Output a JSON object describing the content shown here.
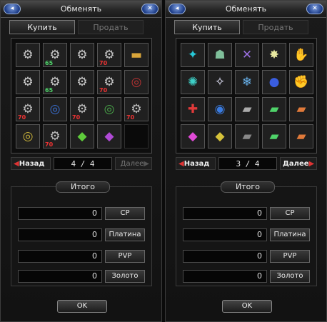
{
  "left": {
    "title": "Обменять",
    "tabs": [
      {
        "label": "Купить",
        "active": true
      },
      {
        "label": "Продать",
        "active": false
      }
    ],
    "slots": [
      {
        "icon": "robot-mech-icon",
        "glyph": "⚙",
        "color": "#c8c8c8",
        "badge": ""
      },
      {
        "icon": "robot-mech-icon",
        "glyph": "⚙",
        "color": "#c8c8c8",
        "badge": "65",
        "badge_color": "#4fd36a"
      },
      {
        "icon": "robot-mech-icon",
        "glyph": "⚙",
        "color": "#c8c8c8",
        "badge": ""
      },
      {
        "icon": "robot-mech-icon",
        "glyph": "⚙",
        "color": "#c8c8c8",
        "badge": "70",
        "badge_color": "#e33"
      },
      {
        "icon": "battery-icon",
        "glyph": "▬",
        "color": "#d9a53a",
        "badge": ""
      },
      {
        "icon": "robot-mech-icon",
        "glyph": "⚙",
        "color": "#d0d0d0",
        "badge": ""
      },
      {
        "icon": "robot-mech-icon",
        "glyph": "⚙",
        "color": "#c8c8c8",
        "badge": "65",
        "badge_color": "#4fd36a"
      },
      {
        "icon": "robot-mech-icon",
        "glyph": "⚙",
        "color": "#c8c8c8",
        "badge": ""
      },
      {
        "icon": "robot-mech-icon",
        "glyph": "⚙",
        "color": "#c8c8c8",
        "badge": "70",
        "badge_color": "#e33"
      },
      {
        "icon": "gear-coil-icon",
        "glyph": "◎",
        "color": "#b33",
        "badge": ""
      },
      {
        "icon": "robot-part-icon",
        "glyph": "⚙",
        "color": "#bdbdbd",
        "badge": "70",
        "badge_color": "#e33"
      },
      {
        "icon": "coil-blue-icon",
        "glyph": "◎",
        "color": "#3a6fd1",
        "badge": ""
      },
      {
        "icon": "robot-part-icon",
        "glyph": "⚙",
        "color": "#bdbdbd",
        "badge": "70",
        "badge_color": "#e33"
      },
      {
        "icon": "coil-green-icon",
        "glyph": "◎",
        "color": "#4aa84a",
        "badge": ""
      },
      {
        "icon": "robot-part-icon",
        "glyph": "⚙",
        "color": "#bdbdbd",
        "badge": "70",
        "badge_color": "#e33"
      },
      {
        "icon": "coil-yellow-icon",
        "glyph": "◎",
        "color": "#c9b23a",
        "badge": ""
      },
      {
        "icon": "robot-part-icon",
        "glyph": "⚙",
        "color": "#bdbdbd",
        "badge": "70",
        "badge_color": "#e33"
      },
      {
        "icon": "robot-green-gem-icon",
        "glyph": "◆",
        "color": "#5ecb3b",
        "badge": ""
      },
      {
        "icon": "robot-purple-gem-icon",
        "glyph": "◆",
        "color": "#b04ad6",
        "badge": ""
      },
      {
        "icon": "empty-slot",
        "glyph": "",
        "color": "#333",
        "badge": ""
      }
    ],
    "pager": {
      "prev": "Назад",
      "page": "4 / 4",
      "next": "Далее",
      "next_enabled": false
    },
    "totals": {
      "title": "Итого",
      "rows": [
        {
          "value": "0",
          "label": "CP"
        },
        {
          "value": "0",
          "label": "Платина"
        },
        {
          "value": "0",
          "label": "PVP"
        },
        {
          "value": "0",
          "label": "Золото"
        }
      ]
    },
    "ok": "OK"
  },
  "right": {
    "title": "Обменять",
    "tabs": [
      {
        "label": "Купить",
        "active": true
      },
      {
        "label": "Продать",
        "active": false
      }
    ],
    "slots": [
      {
        "icon": "skill-cyan-swirl-icon",
        "glyph": "✦",
        "color": "#27c7d6",
        "badge": ""
      },
      {
        "icon": "skill-hooded-figure-icon",
        "glyph": "☗",
        "color": "#7fbf9a",
        "badge": ""
      },
      {
        "icon": "skill-blade-purple-icon",
        "glyph": "✕",
        "color": "#9a6fe0",
        "badge": ""
      },
      {
        "icon": "skill-star-burst-icon",
        "glyph": "✸",
        "color": "#e8e8a0",
        "badge": ""
      },
      {
        "icon": "skill-claw-icon",
        "glyph": "✋",
        "color": "#c9a07a",
        "badge": ""
      },
      {
        "icon": "skill-teal-burst-icon",
        "glyph": "✺",
        "color": "#3ed1c8",
        "badge": ""
      },
      {
        "icon": "skill-light-beam-icon",
        "glyph": "✧",
        "color": "#e8e8ff",
        "badge": ""
      },
      {
        "icon": "skill-ice-icon",
        "glyph": "❄",
        "color": "#6ab5f0",
        "badge": ""
      },
      {
        "icon": "skill-blue-orb-icon",
        "glyph": "●",
        "color": "#3a5ee0",
        "badge": ""
      },
      {
        "icon": "skill-gauntlet-icon",
        "glyph": "✊",
        "color": "#cfcfcf",
        "badge": ""
      },
      {
        "icon": "skill-red-cross-icon",
        "glyph": "✚",
        "color": "#e03a3a",
        "badge": ""
      },
      {
        "icon": "skill-blue-eye-icon",
        "glyph": "◉",
        "color": "#3a7be0",
        "badge": ""
      },
      {
        "icon": "blaster-gray-icon",
        "glyph": "▰",
        "color": "#aaaaaa",
        "badge": ""
      },
      {
        "icon": "blaster-green-icon",
        "glyph": "▰",
        "color": "#4fd36a",
        "badge": ""
      },
      {
        "icon": "blaster-orange-icon",
        "glyph": "▰",
        "color": "#e07a3a",
        "badge": ""
      },
      {
        "icon": "robot-pink-gem-icon",
        "glyph": "◆",
        "color": "#e04ad6",
        "badge": ""
      },
      {
        "icon": "robot-yellow-gem-icon",
        "glyph": "◆",
        "color": "#d6c23a",
        "badge": ""
      },
      {
        "icon": "blaster-dark-icon",
        "glyph": "▰",
        "color": "#888888",
        "badge": ""
      },
      {
        "icon": "blaster-green-icon",
        "glyph": "▰",
        "color": "#4fd36a",
        "badge": ""
      },
      {
        "icon": "blaster-orange-icon",
        "glyph": "▰",
        "color": "#e07a3a",
        "badge": ""
      }
    ],
    "pager": {
      "prev": "Назад",
      "page": "3 / 4",
      "next": "Далее",
      "next_enabled": true
    },
    "totals": {
      "title": "Итого",
      "rows": [
        {
          "value": "0",
          "label": "CP"
        },
        {
          "value": "0",
          "label": "Платина"
        },
        {
          "value": "0",
          "label": "PVP"
        },
        {
          "value": "0",
          "label": "Золото"
        }
      ]
    },
    "ok": "OK"
  }
}
